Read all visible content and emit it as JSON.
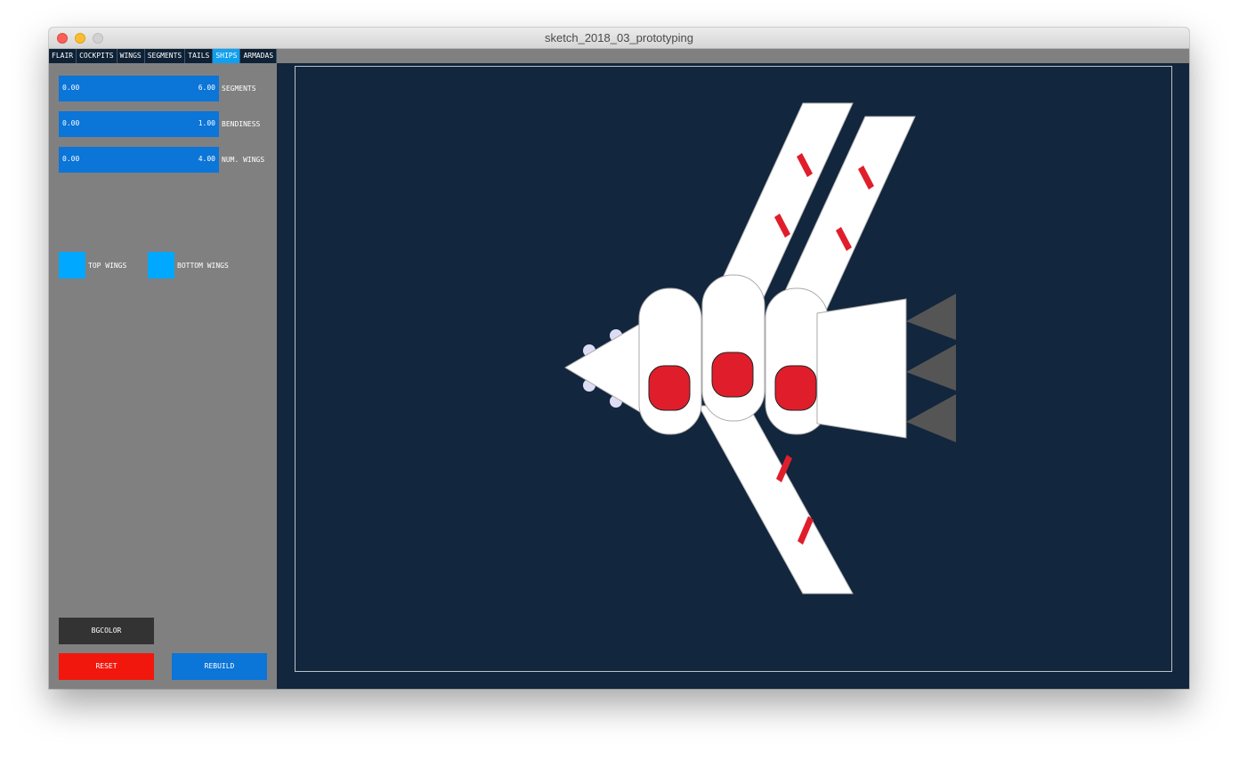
{
  "window": {
    "title": "sketch_2018_03_prototyping"
  },
  "tabs": [
    "FLAIR",
    "COCKPITS",
    "WINGS",
    "SEGMENTS",
    "TAILS",
    "SHIPS",
    "ARMADAS"
  ],
  "active_tab": "SHIPS",
  "sliders": [
    {
      "min_label": "0.00",
      "max_label": "6.00",
      "label": "SEGMENTS"
    },
    {
      "min_label": "0.00",
      "max_label": "1.00",
      "label": "BENDINESS"
    },
    {
      "min_label": "0.00",
      "max_label": "4.00",
      "label": "NUM. WINGS"
    }
  ],
  "toggles": {
    "top_wings": "TOP WINGS",
    "bottom_wings": "BOTTOM WINGS"
  },
  "buttons": {
    "bgcolor": "BGCOLOR",
    "reset": "RESET",
    "rebuild": "REBUILD"
  },
  "colors": {
    "canvas_bg": "#12263d",
    "panel_bg": "#808080",
    "slider": "#0b75d8",
    "toggle": "#00a8ff",
    "active_tab": "#10a0f0",
    "reset": "#f2170c",
    "rebuild": "#0b75d8",
    "bgcolor_button": "#333333",
    "ship_body": "#ffffff",
    "ship_accent": "#e01e2b",
    "tail_fin": "#555555",
    "nose_dots": "#dcdcf5"
  }
}
